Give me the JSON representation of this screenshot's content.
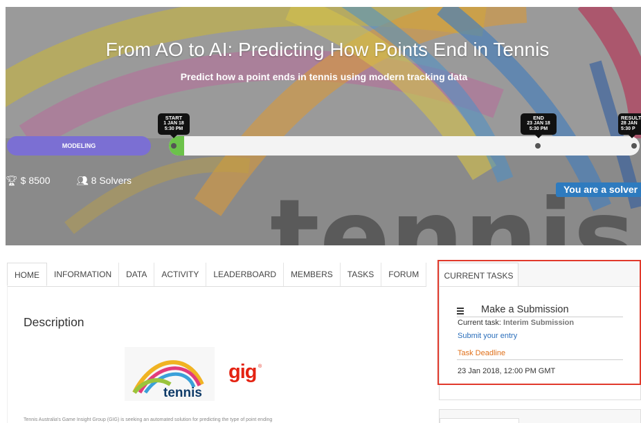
{
  "hero": {
    "title": "From AO to AI: Predicting How Points End in Tennis",
    "subtitle": "Predict how a point ends in tennis using modern tracking data",
    "background_word": "tennis"
  },
  "timeline": {
    "phase_label": "MODELING",
    "start": {
      "label": "START",
      "date": "1 JAN 18",
      "time": "5:30 PM"
    },
    "end": {
      "label": "END",
      "date": "23 JAN 18",
      "time": "5:30 PM"
    },
    "result": {
      "label": "RESULT",
      "date": "28 JAN",
      "time": "5:30 P"
    },
    "progress_color": "#6cc24a",
    "phase_color": "#7b6fd3"
  },
  "stats": {
    "prize_icon": "trophy-icon",
    "prize": "$ 8500",
    "solvers_icon": "users-icon",
    "solvers": "8 Solvers"
  },
  "solver_badge": "You are a solver",
  "tabs": [
    "HOME",
    "INFORMATION",
    "DATA",
    "ACTIVITY",
    "LEADERBOARD",
    "MEMBERS",
    "TASKS",
    "FORUM"
  ],
  "main": {
    "heading": "Description",
    "logos": {
      "tennis": "tennis",
      "gig": "gig"
    },
    "body_text": "Tennis Australia's Game Insight Group (GIG) is seeking an automated solution for predicting the type of point ending"
  },
  "current_tasks": {
    "tab_label": "CURRENT TASKS",
    "task_icon": "list-icon",
    "task_title": "Make a Submission",
    "current_task_label": "Current task:",
    "current_task_value": "Interim Submission",
    "submit_link": "Submit your entry",
    "deadline_label": "Task Deadline",
    "deadline_value": "23 Jan 2018, 12:00 PM GMT",
    "highlight_color": "#e1392b"
  }
}
